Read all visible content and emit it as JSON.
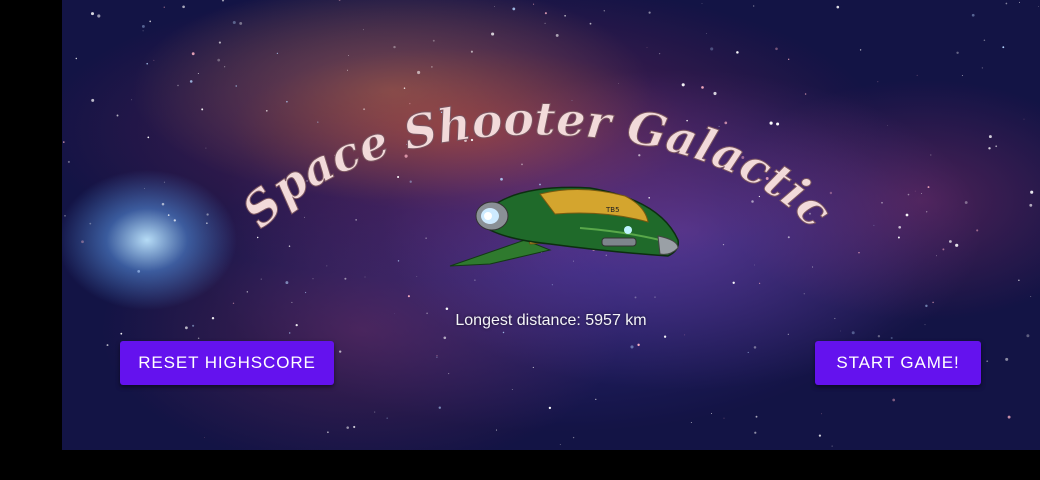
{
  "game": {
    "title": "Space Shooter Galactic",
    "distance_label": "Longest distance:",
    "distance_value": "5957 km",
    "ship_label": "TB5"
  },
  "buttons": {
    "reset_label": "RESET HIGHSCORE",
    "start_label": "START GAME!"
  },
  "colors": {
    "button": "#6412ee",
    "title": "#f2dada",
    "ship_hull": "#1f6a2a",
    "ship_gold": "#d4a52e"
  }
}
